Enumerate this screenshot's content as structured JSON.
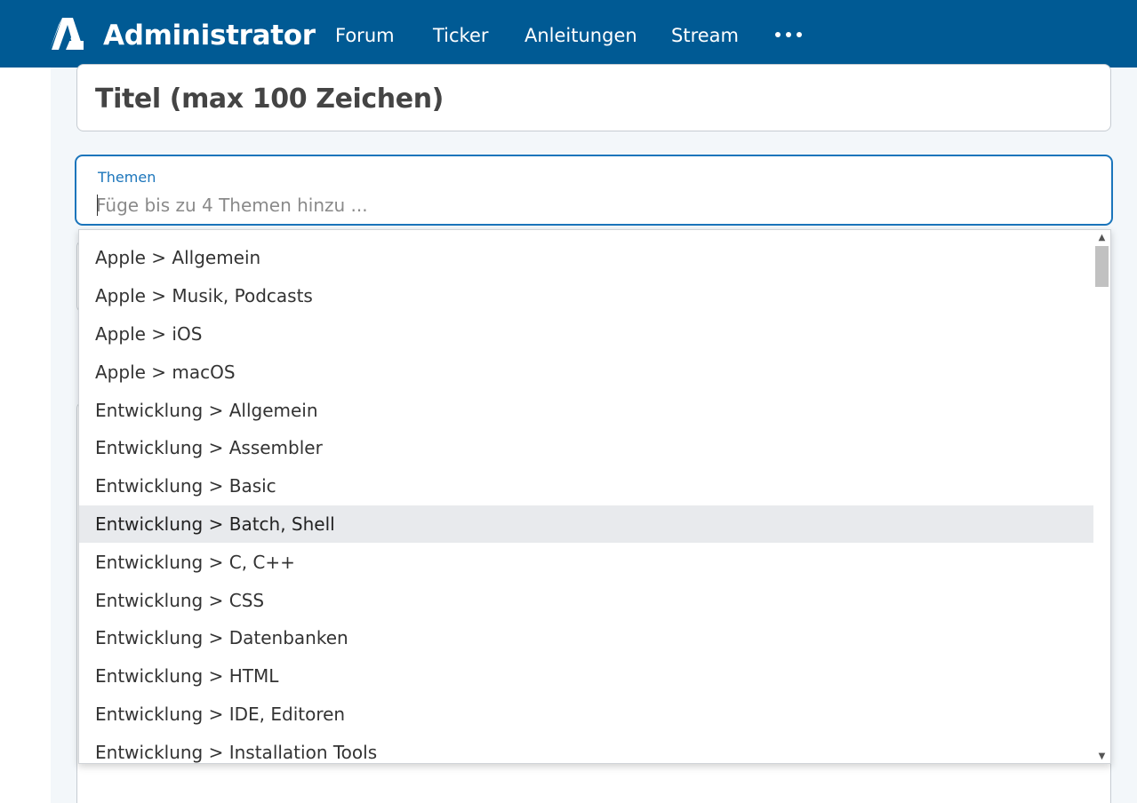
{
  "header": {
    "brand": "Administrator",
    "nav": [
      "Forum",
      "Ticker",
      "Anleitungen",
      "Stream"
    ],
    "more_icon": "more-dots-icon",
    "background_color": "#005a94"
  },
  "title_field": {
    "placeholder": "Titel (max 100 Zeichen)"
  },
  "themen_field": {
    "label": "Themen",
    "placeholder": "Füge bis zu 4 Themen hinzu ...",
    "value": "",
    "accent_color": "#1b75bb"
  },
  "dropdown": {
    "items": [
      "Apple > Allgemein",
      "Apple > Musik, Podcasts",
      "Apple > iOS",
      "Apple > macOS",
      "Entwicklung > Allgemein",
      "Entwicklung > Assembler",
      "Entwicklung > Basic",
      "Entwicklung > Batch, Shell",
      "Entwicklung > C, C++",
      "Entwicklung > CSS",
      "Entwicklung > Datenbanken",
      "Entwicklung > HTML",
      "Entwicklung > IDE, Editoren",
      "Entwicklung > Installation Tools"
    ],
    "highlighted_item": "Entwicklung > Batch, Shell"
  }
}
